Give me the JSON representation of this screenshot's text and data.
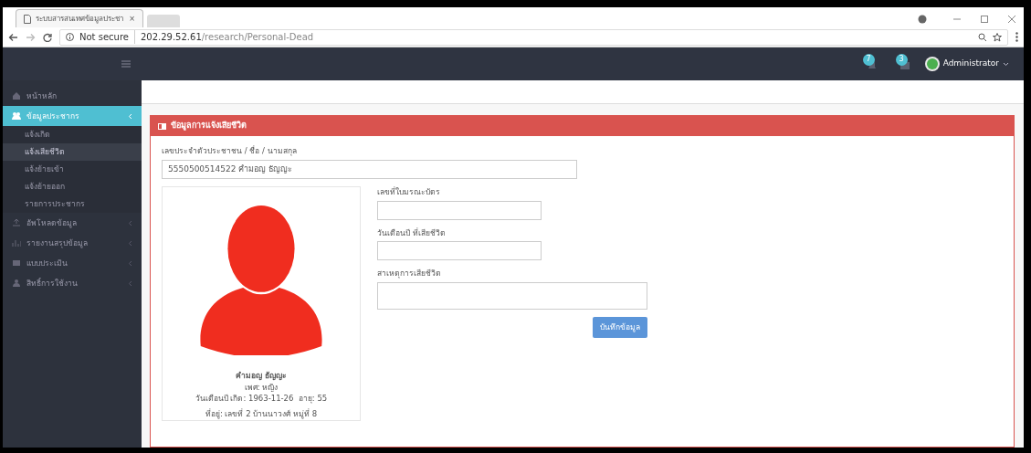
{
  "browser": {
    "tab_title": "ระบบสารสนเทศข้อมูลประชา",
    "tab_close": "×",
    "security": "Not secure",
    "url_host": "202.29.52.61",
    "url_path": "/research/Personal-Dead"
  },
  "navbar": {
    "notifications": [
      {
        "count": "7"
      },
      {
        "count": "3"
      }
    ],
    "user": "Administrator"
  },
  "sidebar": {
    "items": [
      {
        "label": "หน้าหลัก",
        "selected": false,
        "expandable": false
      },
      {
        "label": "ข้อมูลประชากร",
        "selected": true,
        "expandable": true,
        "children": [
          {
            "label": "แจ้งเกิด",
            "selected": false
          },
          {
            "label": "แจ้งเสียชีวิต",
            "selected": true
          },
          {
            "label": "แจ้งย้ายเข้า",
            "selected": false
          },
          {
            "label": "แจ้งย้ายออก",
            "selected": false
          },
          {
            "label": "รายการประชากร",
            "selected": false
          }
        ]
      },
      {
        "label": "อัพโหลดข้อมูล",
        "selected": false,
        "expandable": true
      },
      {
        "label": "รายงานสรุปข้อมูล",
        "selected": false,
        "expandable": true
      },
      {
        "label": "แบบประเมิน",
        "selected": false,
        "expandable": true
      },
      {
        "label": "สิทธิ์การใช้งาน",
        "selected": false,
        "expandable": true
      }
    ]
  },
  "panel": {
    "title": "ข้อมูลการแจ้งเสียชีวิต",
    "search": {
      "label": "เลขประจำตัวประชาชน / ชื่อ / นามสกุล",
      "value": "5550500514522 คำมอญ ธัญญะ"
    },
    "profile": {
      "name": "คำมอญ ธัญญะ",
      "gender": "เพศ: หญิง",
      "birth": "วันเดือนปี เกิด: 1963-11-26  อายุ: 55",
      "address": "ที่อยู่: เลขที่ 2 บ้านนาวงศ์ หมู่ที่ 8"
    },
    "fields": [
      {
        "label": "เลขที่ใบมรณะบัตร",
        "kind": "input"
      },
      {
        "label": "วันเดือนปี ที่เสียชีวิต",
        "kind": "input"
      },
      {
        "label": "สาเหตุการเสียชีวิต",
        "kind": "textarea"
      }
    ],
    "save_button": "บันทึกข้อมูล"
  }
}
